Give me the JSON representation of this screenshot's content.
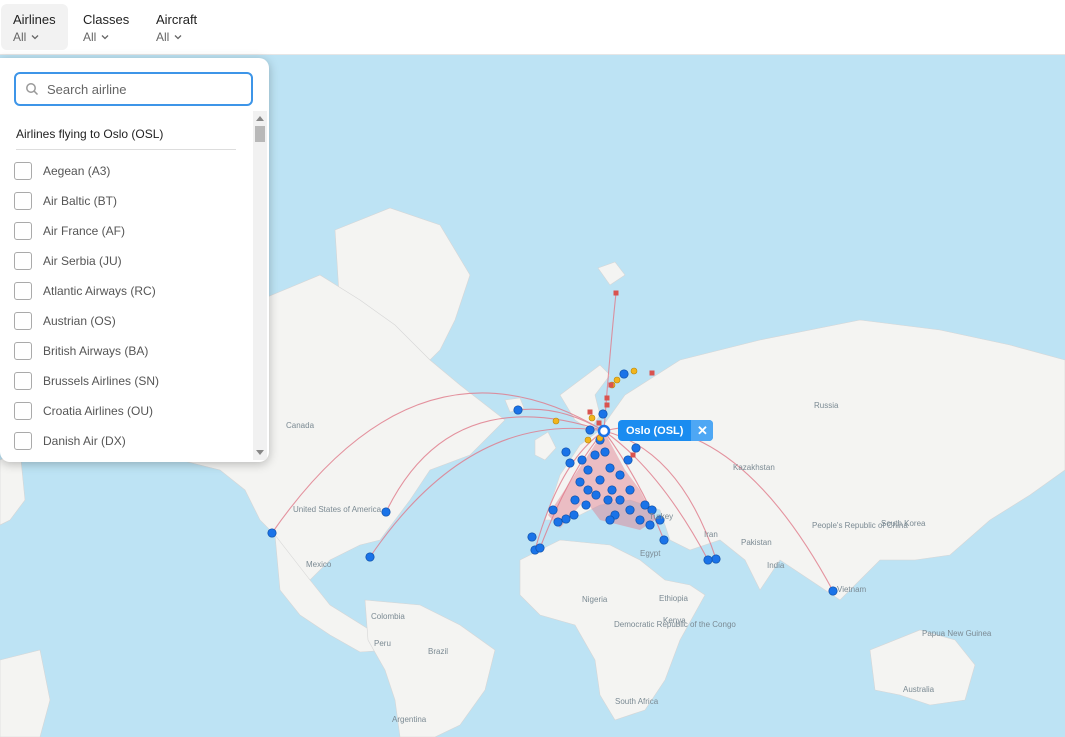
{
  "filters": {
    "airlines": {
      "label": "Airlines",
      "value": "All"
    },
    "classes": {
      "label": "Classes",
      "value": "All"
    },
    "aircraft": {
      "label": "Aircraft",
      "value": "All"
    }
  },
  "dropdown": {
    "search_placeholder": "Search airline",
    "heading": "Airlines flying to Oslo (OSL)",
    "items": [
      "Aegean (A3)",
      "Air Baltic (BT)",
      "Air France (AF)",
      "Air Serbia (JU)",
      "Atlantic Airways (RC)",
      "Austrian (OS)",
      "British Airways (BA)",
      "Brussels Airlines (SN)",
      "Croatia Airlines (OU)",
      "Danish Air (DX)"
    ]
  },
  "map": {
    "selected_airport": "Oslo (OSL)",
    "labels": [
      "Canada",
      "United States of America",
      "Mexico",
      "Colombia",
      "Peru",
      "Brazil",
      "Argentina",
      "Russia",
      "Kazakhstan",
      "Turkey",
      "Egypt",
      "Iran",
      "Pakistan",
      "India",
      "Nigeria",
      "Ethiopia",
      "Kenya",
      "Democratic Republic of the Congo",
      "South Africa",
      "People's Republic of China",
      "South Korea",
      "Vietnam",
      "Australia",
      "Papua New Guinea"
    ],
    "colors": {
      "ocean": "#bde3f4",
      "land": "#f4f4f2",
      "route": "#e07a8a",
      "airport_blue": "#1a73e8",
      "airport_yellow": "#f2b51c",
      "airport_red": "#d9534f"
    }
  }
}
